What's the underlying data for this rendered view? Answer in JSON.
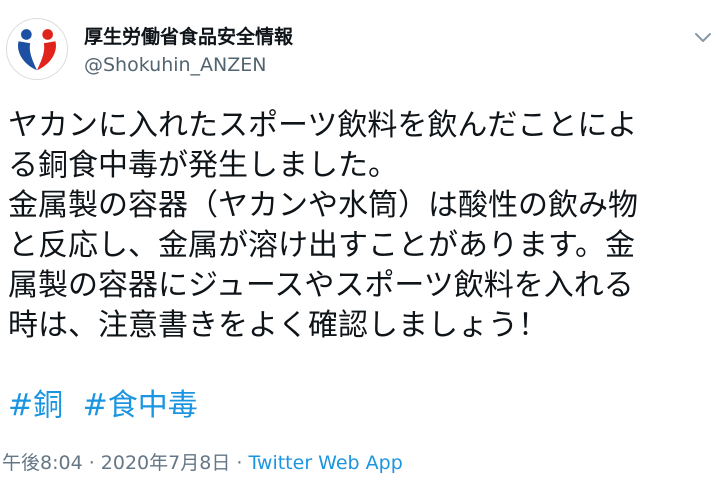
{
  "author": {
    "display_name": "厚生労働省食品安全情報",
    "handle": "@Shokuhin_ANZEN"
  },
  "icons": {
    "avatar": "mhlw-logo-icon",
    "menu": "chevron-down-icon"
  },
  "colors": {
    "link": "#1b95e0",
    "text": "#0f1419",
    "meta": "#657786",
    "logo_blue": "#1d4fa3",
    "logo_red": "#e0241b"
  },
  "tweet": {
    "lines": [
      "ヤカンに入れたスポーツ飲料を飲んだことによ",
      "る銅食中毒が発生しました。",
      "金属製の容器（ヤカンや水筒）は酸性の飲み物",
      "と反応し、金属が溶け出すことがあります。金",
      "属製の容器にジュースやスポーツ飲料を入れる",
      "時は、注意書きをよく確認しましょう！"
    ],
    "hashtags": [
      "#銅",
      "#食中毒"
    ]
  },
  "meta": {
    "time": "午後8:04",
    "separator1": " · ",
    "date": "2020年7月8日",
    "separator2": " · ",
    "source": "Twitter Web App"
  }
}
